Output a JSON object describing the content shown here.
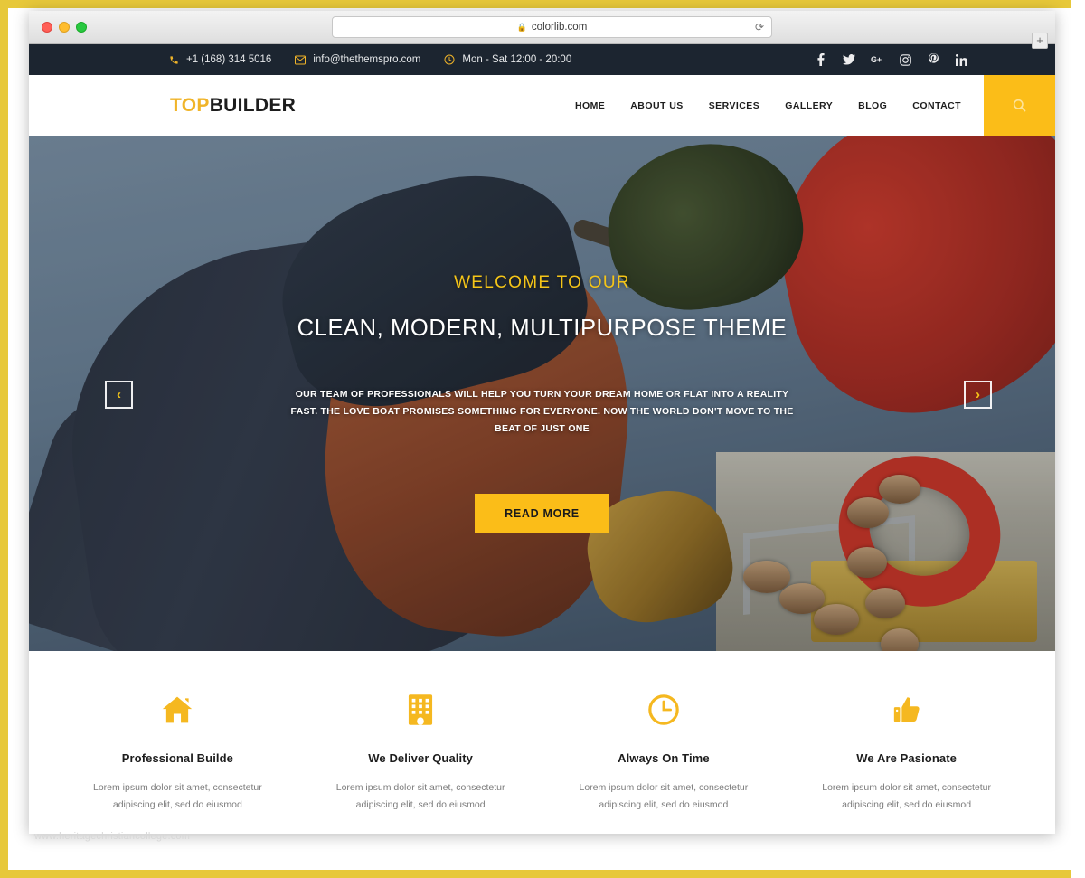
{
  "browser": {
    "url": "colorlib.com",
    "lock_icon": "lock-icon",
    "reload_icon": "reload-icon",
    "new_tab_label": "+",
    "traffic_lights": [
      "close",
      "minimize",
      "maximize"
    ]
  },
  "topbar": {
    "background": "#1c2530",
    "accent": "#f0b429",
    "phone": "+1 (168) 314 5016",
    "email": "info@thethemspro.com",
    "hours": "Mon - Sat 12:00 - 20:00",
    "phone_icon": "phone-icon",
    "email_icon": "envelope-icon",
    "clock_icon": "clock-icon",
    "social": [
      {
        "name": "facebook-icon",
        "label": "f"
      },
      {
        "name": "twitter-icon",
        "label": "t"
      },
      {
        "name": "google-plus-icon",
        "label": "G+"
      },
      {
        "name": "instagram-icon",
        "label": "ig"
      },
      {
        "name": "pinterest-icon",
        "label": "P"
      },
      {
        "name": "linkedin-icon",
        "label": "in"
      }
    ]
  },
  "header": {
    "logo_part1": "TOP",
    "logo_part2": "BUILDER",
    "logo_color1": "#f0b429",
    "logo_color2": "#1d1d1d",
    "nav": [
      {
        "label": "HOME"
      },
      {
        "label": "ABOUT US"
      },
      {
        "label": "SERVICES"
      },
      {
        "label": "GALLERY"
      },
      {
        "label": "BLOG"
      },
      {
        "label": "CONTACT"
      }
    ],
    "search_icon": "search-icon",
    "search_bg": "#fbbd18"
  },
  "hero": {
    "subtitle": "WELCOME TO OUR",
    "title": "CLEAN, MODERN, MULTIPURPOSE THEME",
    "description": "OUR TEAM OF PROFESSIONALS WILL HELP YOU TURN YOUR DREAM HOME OR FLAT INTO A REALITY FAST. THE LOVE BOAT PROMISES SOMETHING FOR EVERYONE. NOW THE WORLD DON'T MOVE TO THE BEAT OF JUST ONE",
    "cta_label": "READ MORE",
    "cta_color": "#fbbd18",
    "subtitle_color": "#f5c518",
    "prev_label": "‹",
    "next_label": "›"
  },
  "features": [
    {
      "icon": "home-icon",
      "title": "Professional Builde",
      "text": "Lorem ipsum dolor sit amet, consectetur adipiscing elit, sed do eiusmod"
    },
    {
      "icon": "building-icon",
      "title": "We Deliver Quality",
      "text": "Lorem ipsum dolor sit amet, consectetur adipiscing elit, sed do eiusmod"
    },
    {
      "icon": "clock-icon",
      "title": "Always On Time",
      "text": "Lorem ipsum dolor sit amet, consectetur adipiscing elit, sed do eiusmod"
    },
    {
      "icon": "thumbs-up-icon",
      "title": "We Are Pasionate",
      "text": "Lorem ipsum dolor sit amet, consectetur adipiscing elit, sed do eiusmod"
    }
  ],
  "watermark": "www.heritagechristiancollege.com"
}
